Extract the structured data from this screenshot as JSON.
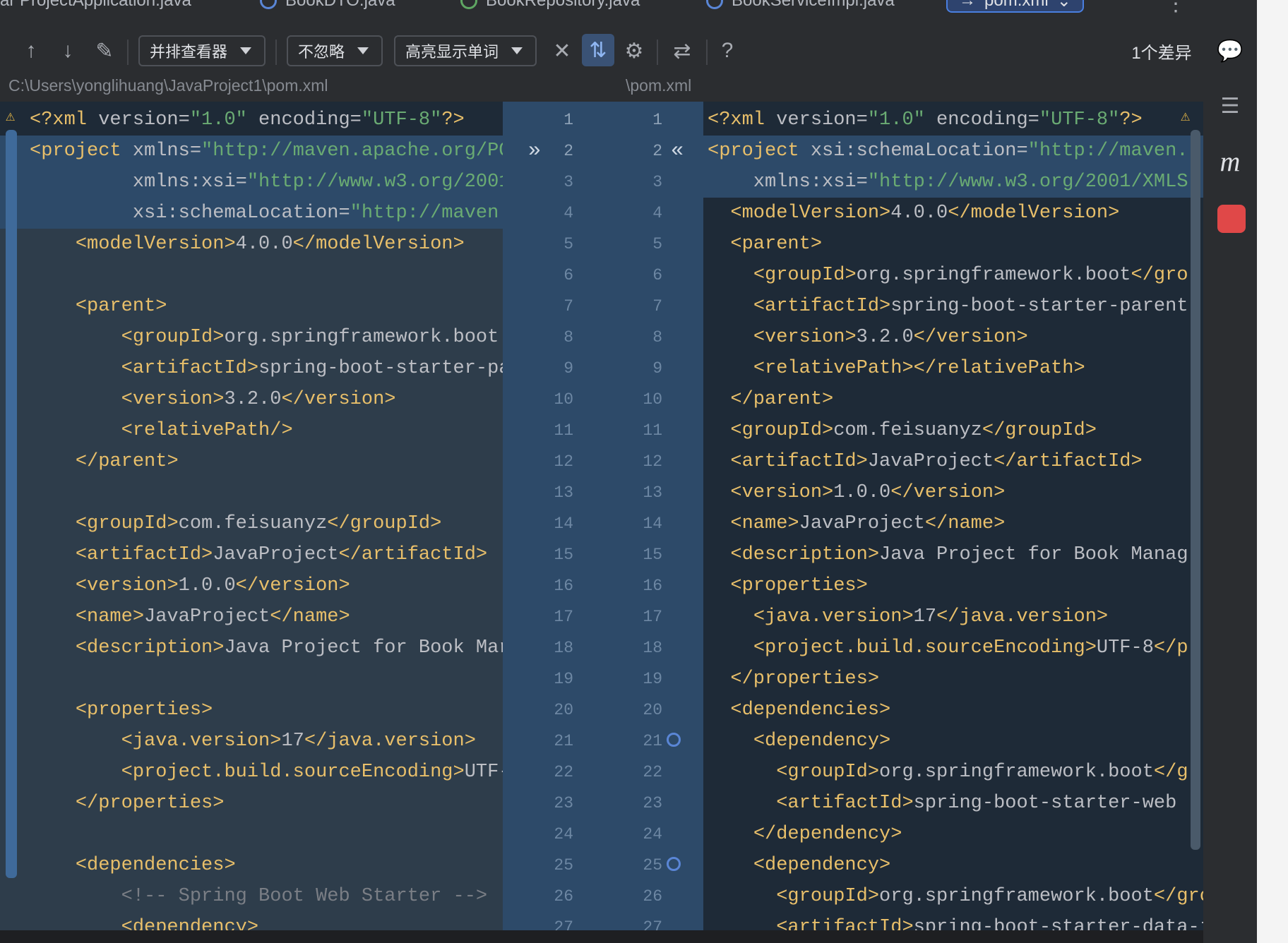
{
  "tabs": [
    {
      "label": "ar ProjectApplication.java",
      "icon": "none"
    },
    {
      "label": "BookDTO.java",
      "icon": "class-icon"
    },
    {
      "label": "BookRepository.java",
      "icon": "interface-icon"
    },
    {
      "label": "BookServiceImpl.java",
      "icon": "class-icon"
    },
    {
      "label": "pom.xml",
      "icon": "maven-icon",
      "active": true
    }
  ],
  "toolbar": {
    "viewer": "并排查看器",
    "ignore": "不忽略",
    "highlight": "高亮显示单词",
    "help": "?",
    "diff_count": "1个差异"
  },
  "paths": {
    "left": "C:\\Users\\yonglihuang\\JavaProject1\\pom.xml",
    "right": "\\pom.xml"
  },
  "left_lines": [
    "<?xml version=\"1.0\" encoding=\"UTF-8\"?>",
    "<project xmlns=\"http://maven.apache.org/PO",
    "         xmlns:xsi=\"http://www.w3.org/2001",
    "         xsi:schemaLocation=\"http://maven.",
    "    <modelVersion>4.0.0</modelVersion>",
    "",
    "    <parent>",
    "        <groupId>org.springframework.boot<",
    "        <artifactId>spring-boot-starter-pa",
    "        <version>3.2.0</version>",
    "        <relativePath/>",
    "    </parent>",
    "",
    "    <groupId>com.feisuanyz</groupId>",
    "    <artifactId>JavaProject</artifactId>",
    "    <version>1.0.0</version>",
    "    <name>JavaProject</name>",
    "    <description>Java Project for Book Mar",
    "",
    "    <properties>",
    "        <java.version>17</java.version>",
    "        <project.build.sourceEncoding>UTF-",
    "    </properties>",
    "",
    "    <dependencies>",
    "        <!-- Spring Boot Web Starter -->",
    "        <dependency>"
  ],
  "right_lines": [
    "<?xml version=\"1.0\" encoding=\"UTF-8\"?>",
    "<project xsi:schemaLocation=\"http://maven.",
    "    xmlns:xsi=\"http://www.w3.org/2001/XMLS",
    "  <modelVersion>4.0.0</modelVersion>",
    "  <parent>",
    "    <groupId>org.springframework.boot</gro",
    "    <artifactId>spring-boot-starter-parent",
    "    <version>3.2.0</version>",
    "    <relativePath></relativePath>",
    "  </parent>",
    "  <groupId>com.feisuanyz</groupId>",
    "  <artifactId>JavaProject</artifactId>",
    "  <version>1.0.0</version>",
    "  <name>JavaProject</name>",
    "  <description>Java Project for Book Manag",
    "  <properties>",
    "    <java.version>17</java.version>",
    "    <project.build.sourceEncoding>UTF-8</p",
    "  </properties>",
    "  <dependencies>",
    "    <dependency>",
    "      <groupId>org.springframework.boot</g",
    "      <artifactId>spring-boot-starter-web<",
    "    </dependency>",
    "    <dependency>",
    "      <groupId>org.springframework.boot</gro",
    "      <artifactId>spring-boot-starter-data-j"
  ],
  "gutter_left": [
    "1",
    "2",
    "3",
    "4",
    "5",
    "6",
    "7",
    "8",
    "9",
    "10",
    "11",
    "12",
    "13",
    "14",
    "15",
    "16",
    "17",
    "18",
    "19",
    "20",
    "21",
    "22",
    "23",
    "24",
    "25",
    "26",
    "27"
  ],
  "gutter_right": [
    "1",
    "2",
    "3",
    "4",
    "5",
    "6",
    "7",
    "8",
    "9",
    "10",
    "11",
    "12",
    "13",
    "14",
    "15",
    "16",
    "17",
    "18",
    "19",
    "20",
    "21",
    "22",
    "23",
    "24",
    "25",
    "26",
    "27"
  ],
  "sidebar_icons": [
    "ai-assistant-icon",
    "database-icon",
    "maven-icon",
    "feisuan-icon"
  ],
  "colors": {
    "tag": "#e8bf6a",
    "string": "#6aab73",
    "attr_prefix": "#c77dbb",
    "comment": "#7a7e85",
    "highlight": "#2d4a69"
  }
}
